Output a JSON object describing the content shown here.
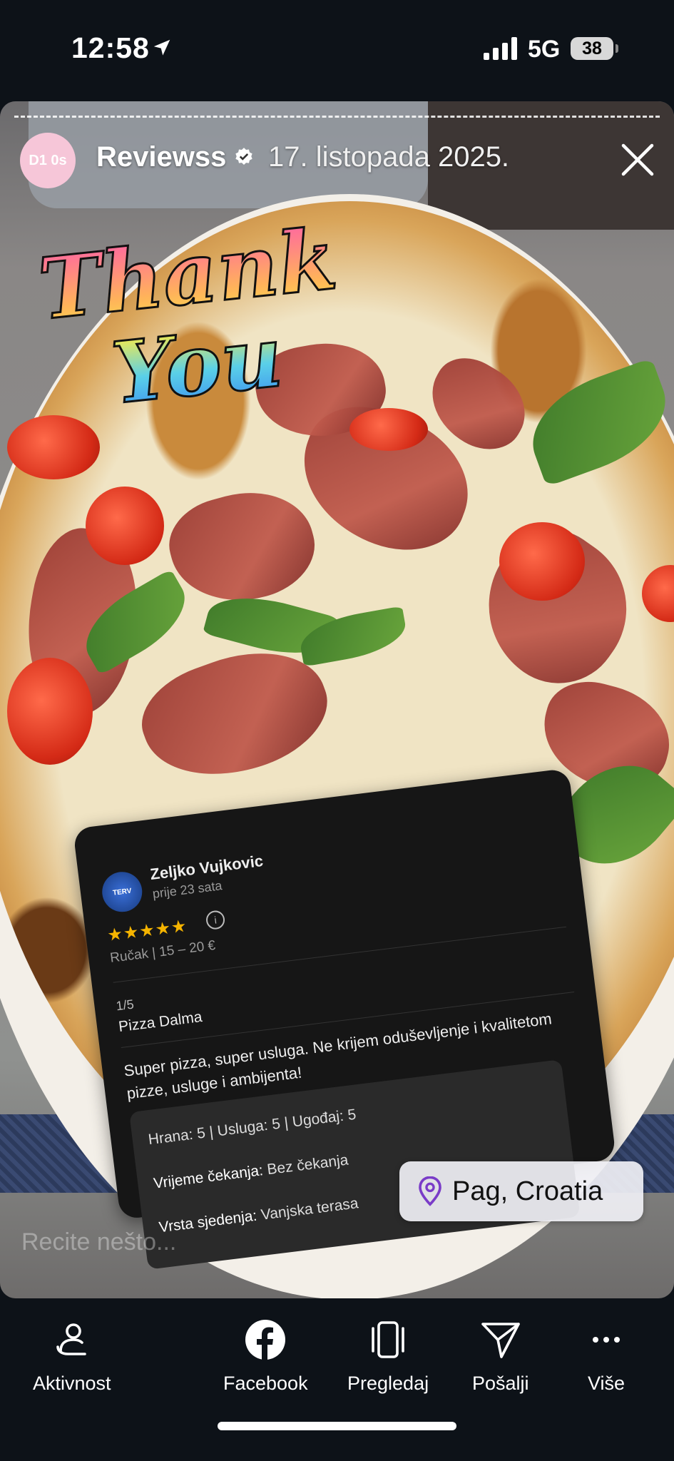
{
  "status_bar": {
    "time": "12:58",
    "network": "5G",
    "battery": "38"
  },
  "story": {
    "progress_segments": 1,
    "avatar_text": "D1 0s",
    "username": "Reviewss",
    "verified": true,
    "date": "17. listopada 2025.",
    "sticker_lines": [
      "Thank",
      "You"
    ],
    "location": "Pag, Croatia",
    "message_placeholder": "Recite nešto..."
  },
  "review": {
    "avatar_text": "TERV",
    "reviewer": "Zeljko Vujkovic",
    "time": "prije 23 sata",
    "stars": "★★★★★",
    "rating": 5,
    "meta": "Ručak | 15 – 20 €",
    "counter": "1/5",
    "dish": "Pizza Dalma",
    "text": "Super pizza, super usluga. Ne krijem oduševljenje i kvalitetom pizze, usluge i ambijenta!",
    "scores": "Hrana: 5 | Usluga: 5 | Ugođaj: 5",
    "wait_label": "Vrijeme čekanja:",
    "wait_value": "Bez čekanja",
    "seating_label": "Vrsta sjedenja:",
    "seating_value": "Vanjska terasa"
  },
  "bottom_nav": [
    {
      "label": "Aktivnost",
      "icon": "activity-icon"
    },
    {
      "label": "Facebook",
      "icon": "facebook-icon"
    },
    {
      "label": "Pregledaj",
      "icon": "browse-icon"
    },
    {
      "label": "Pošalji",
      "icon": "send-icon"
    },
    {
      "label": "Više",
      "icon": "more-icon"
    }
  ],
  "colors": {
    "background": "#0d1218",
    "star": "#f5b400",
    "card": "#161616",
    "pin": "#7a3cc8"
  }
}
